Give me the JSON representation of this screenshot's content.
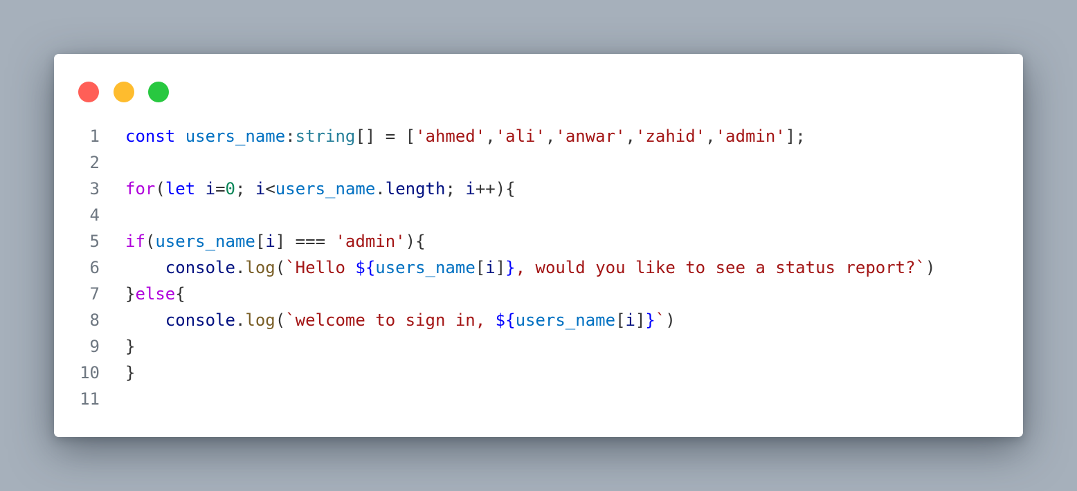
{
  "window": {
    "controls": [
      {
        "name": "close",
        "color": "#ff5f57"
      },
      {
        "name": "minimize",
        "color": "#febc2e"
      },
      {
        "name": "maximize",
        "color": "#28c840"
      }
    ]
  },
  "code": {
    "language": "typescript",
    "lines": [
      {
        "number": "1",
        "tokens": [
          {
            "t": "const",
            "k": "kw"
          },
          {
            "t": " ",
            "k": "plain"
          },
          {
            "t": "users_name",
            "k": "var"
          },
          {
            "t": ":",
            "k": "plain"
          },
          {
            "t": "string",
            "k": "type"
          },
          {
            "t": "[] = [",
            "k": "plain"
          },
          {
            "t": "'ahmed'",
            "k": "str"
          },
          {
            "t": ",",
            "k": "plain"
          },
          {
            "t": "'ali'",
            "k": "str"
          },
          {
            "t": ",",
            "k": "plain"
          },
          {
            "t": "'anwar'",
            "k": "str"
          },
          {
            "t": ",",
            "k": "plain"
          },
          {
            "t": "'zahid'",
            "k": "str"
          },
          {
            "t": ",",
            "k": "plain"
          },
          {
            "t": "'admin'",
            "k": "str"
          },
          {
            "t": "];",
            "k": "plain"
          }
        ]
      },
      {
        "number": "2",
        "tokens": []
      },
      {
        "number": "3",
        "tokens": [
          {
            "t": "for",
            "k": "ctl"
          },
          {
            "t": "(",
            "k": "plain"
          },
          {
            "t": "let",
            "k": "kw"
          },
          {
            "t": " ",
            "k": "plain"
          },
          {
            "t": "i",
            "k": "ident"
          },
          {
            "t": "=",
            "k": "plain"
          },
          {
            "t": "0",
            "k": "num"
          },
          {
            "t": "; ",
            "k": "plain"
          },
          {
            "t": "i",
            "k": "ident"
          },
          {
            "t": "<",
            "k": "plain"
          },
          {
            "t": "users_name",
            "k": "var"
          },
          {
            "t": ".",
            "k": "plain"
          },
          {
            "t": "length",
            "k": "prop"
          },
          {
            "t": "; ",
            "k": "plain"
          },
          {
            "t": "i",
            "k": "ident"
          },
          {
            "t": "++){",
            "k": "plain"
          }
        ]
      },
      {
        "number": "4",
        "tokens": []
      },
      {
        "number": "5",
        "tokens": [
          {
            "t": "if",
            "k": "ctl"
          },
          {
            "t": "(",
            "k": "plain"
          },
          {
            "t": "users_name",
            "k": "var"
          },
          {
            "t": "[",
            "k": "plain"
          },
          {
            "t": "i",
            "k": "ident"
          },
          {
            "t": "] === ",
            "k": "plain"
          },
          {
            "t": "'admin'",
            "k": "str"
          },
          {
            "t": "){",
            "k": "plain"
          }
        ]
      },
      {
        "number": "6",
        "tokens": [
          {
            "t": "    ",
            "k": "plain"
          },
          {
            "t": "console",
            "k": "prop"
          },
          {
            "t": ".",
            "k": "plain"
          },
          {
            "t": "log",
            "k": "fn"
          },
          {
            "t": "(",
            "k": "plain"
          },
          {
            "t": "`Hello ",
            "k": "str"
          },
          {
            "t": "${",
            "k": "interp"
          },
          {
            "t": "users_name",
            "k": "var"
          },
          {
            "t": "[",
            "k": "plain"
          },
          {
            "t": "i",
            "k": "ident"
          },
          {
            "t": "]",
            "k": "plain"
          },
          {
            "t": "}",
            "k": "interp"
          },
          {
            "t": ", would you like to see a status report?`",
            "k": "str"
          },
          {
            "t": ")",
            "k": "plain"
          }
        ]
      },
      {
        "number": "7",
        "tokens": [
          {
            "t": "}",
            "k": "plain"
          },
          {
            "t": "else",
            "k": "ctl"
          },
          {
            "t": "{",
            "k": "plain"
          }
        ]
      },
      {
        "number": "8",
        "tokens": [
          {
            "t": "    ",
            "k": "plain"
          },
          {
            "t": "console",
            "k": "prop"
          },
          {
            "t": ".",
            "k": "plain"
          },
          {
            "t": "log",
            "k": "fn"
          },
          {
            "t": "(",
            "k": "plain"
          },
          {
            "t": "`welcome to sign in, ",
            "k": "str"
          },
          {
            "t": "${",
            "k": "interp"
          },
          {
            "t": "users_name",
            "k": "var"
          },
          {
            "t": "[",
            "k": "plain"
          },
          {
            "t": "i",
            "k": "ident"
          },
          {
            "t": "]",
            "k": "plain"
          },
          {
            "t": "}",
            "k": "interp"
          },
          {
            "t": "`",
            "k": "str"
          },
          {
            "t": ")",
            "k": "plain"
          }
        ]
      },
      {
        "number": "9",
        "tokens": [
          {
            "t": "}",
            "k": "plain"
          }
        ]
      },
      {
        "number": "10",
        "tokens": [
          {
            "t": "}",
            "k": "plain"
          }
        ]
      },
      {
        "number": "11",
        "tokens": []
      }
    ]
  }
}
